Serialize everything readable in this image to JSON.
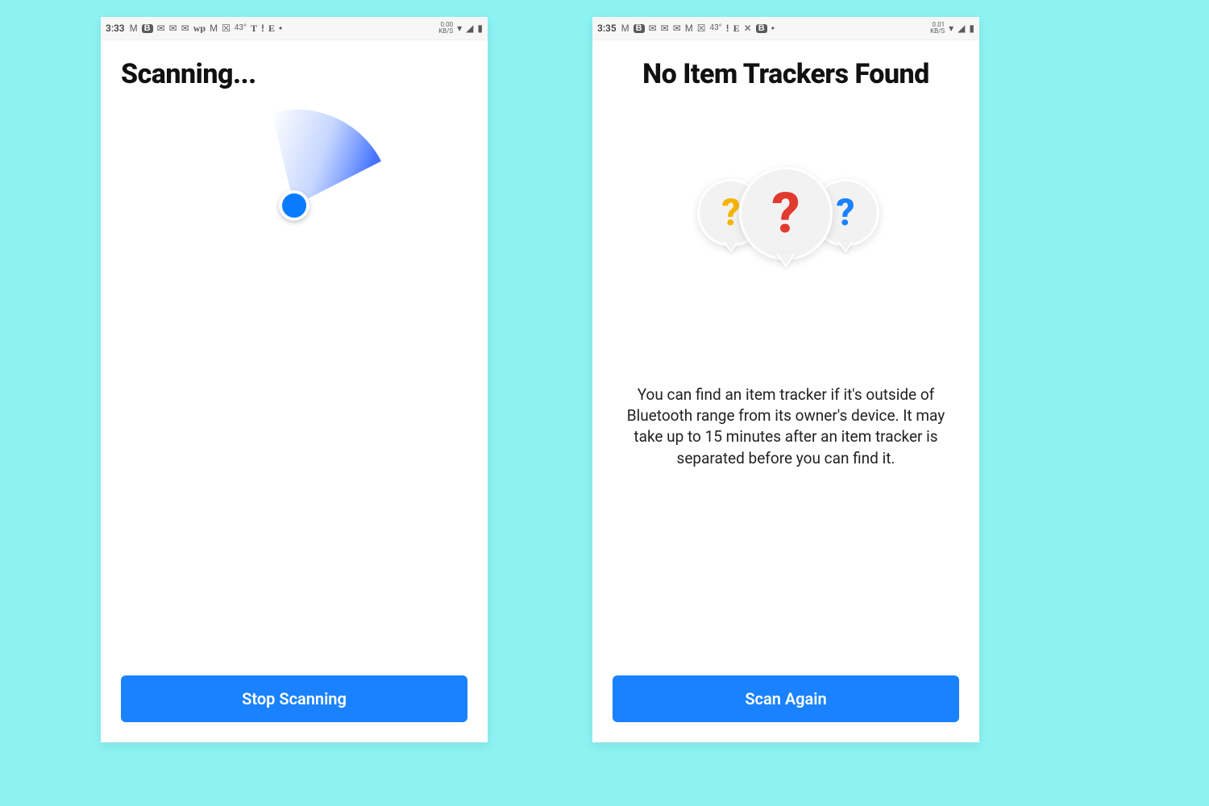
{
  "left": {
    "statusbar": {
      "time": "3:33",
      "temp": "43°",
      "kb_top": "0.00",
      "kb_bot": "KB/S"
    },
    "title": "Scanning...",
    "button": "Stop Scanning"
  },
  "right": {
    "statusbar": {
      "time": "3:35",
      "temp": "43°",
      "kb_top": "0.01",
      "kb_bot": "KB/S"
    },
    "title": "No Item Trackers Found",
    "body": "You can find an item tracker if it's outside of Bluetooth range from its owner's device. It may take up to 15 minutes after an item tracker is separated before you can find it.",
    "button": "Scan Again",
    "q1": "?",
    "q2": "?",
    "q3": "?"
  }
}
